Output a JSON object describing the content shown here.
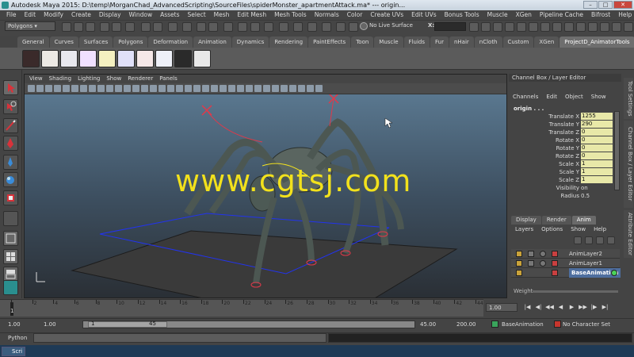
{
  "window": {
    "title": "Autodesk Maya 2015: D:\\temp\\MorganChad_AdvancedScripting\\SourceFiles\\spiderMonster_apartmentAttack.ma*  ---  origin..."
  },
  "menubar": [
    "File",
    "Edit",
    "Modify",
    "Create",
    "Display",
    "Window",
    "Assets",
    "Select",
    "Mesh",
    "Edit Mesh",
    "Mesh Tools",
    "Normals",
    "Color",
    "Create UVs",
    "Edit UVs",
    "Bonus Tools",
    "Muscle",
    "XGen",
    "Pipeline Cache",
    "Bifrost",
    "Help"
  ],
  "statusline": {
    "mode": "Polygons",
    "live_surface": "No Live Surface",
    "x_label": "X:"
  },
  "shelf_tabs": [
    "General",
    "Curves",
    "Surfaces",
    "Polygons",
    "Deformation",
    "Animation",
    "Dynamics",
    "Rendering",
    "PaintEffects",
    "Toon",
    "Muscle",
    "Fluids",
    "Fur",
    "nHair",
    "nCloth",
    "Custom",
    "XGen",
    "ProjectD_AnimatorTools"
  ],
  "shelf_active": "ProjectD_AnimatorTools",
  "viewport": {
    "menu": [
      "View",
      "Shading",
      "Lighting",
      "Show",
      "Renderer",
      "Panels"
    ],
    "watermark": "www.cgtsj.com"
  },
  "channel_box": {
    "header": "Channel Box / Layer Editor",
    "menu": [
      "Channels",
      "Edit",
      "Object",
      "Show"
    ],
    "object": "origin . . .",
    "channels": [
      {
        "label": "Translate X",
        "value": "1255",
        "editable": true
      },
      {
        "label": "Translate Y",
        "value": "290",
        "editable": true
      },
      {
        "label": "Translate Z",
        "value": "0",
        "editable": true
      },
      {
        "label": "Rotate X",
        "value": "0",
        "editable": true
      },
      {
        "label": "Rotate Y",
        "value": "0",
        "editable": true
      },
      {
        "label": "Rotate Z",
        "value": "0",
        "editable": true
      },
      {
        "label": "Scale X",
        "value": "1",
        "editable": true
      },
      {
        "label": "Scale Y",
        "value": "1",
        "editable": true
      },
      {
        "label": "Scale Z",
        "value": "1",
        "editable": true
      },
      {
        "label": "Visibility",
        "value": "on",
        "editable": false
      },
      {
        "label": "Radius",
        "value": "0.5",
        "editable": false
      }
    ]
  },
  "side_tabs": [
    "Tool Settings",
    "Channel Box / Layer Editor",
    "Attribute Editor"
  ],
  "layer_editor": {
    "tabs": [
      "Display",
      "Render",
      "Anim"
    ],
    "active_tab": "Anim",
    "menu": [
      "Layers",
      "Options",
      "Show",
      "Help"
    ],
    "layers": [
      "AnimLayer2",
      "AnimLayer1",
      "BaseAnimation"
    ],
    "weight_label": "Weight"
  },
  "timeline": {
    "ticks": [
      "1",
      "2",
      "4",
      "6",
      "8",
      "10",
      "12",
      "14",
      "16",
      "18",
      "20",
      "22",
      "24",
      "26",
      "28",
      "30",
      "32",
      "34",
      "36",
      "38",
      "40",
      "42",
      "44"
    ],
    "current_frame_label": "1",
    "current_frame": "1.00",
    "controls": [
      "|◀",
      "◀|",
      "◀◀",
      "◀",
      "▶",
      "▶▶",
      "|▶",
      "▶|"
    ]
  },
  "range": {
    "start": "1.00",
    "anim_start": "1.00",
    "slider_start": "1",
    "slider_end": "45",
    "playback_end": "45.00",
    "anim_end": "200.00",
    "anim_layer": "BaseAnimation",
    "character_set": "No Character Set"
  },
  "command_line": {
    "label": "Python"
  },
  "taskbar": {
    "item": "Scri"
  }
}
